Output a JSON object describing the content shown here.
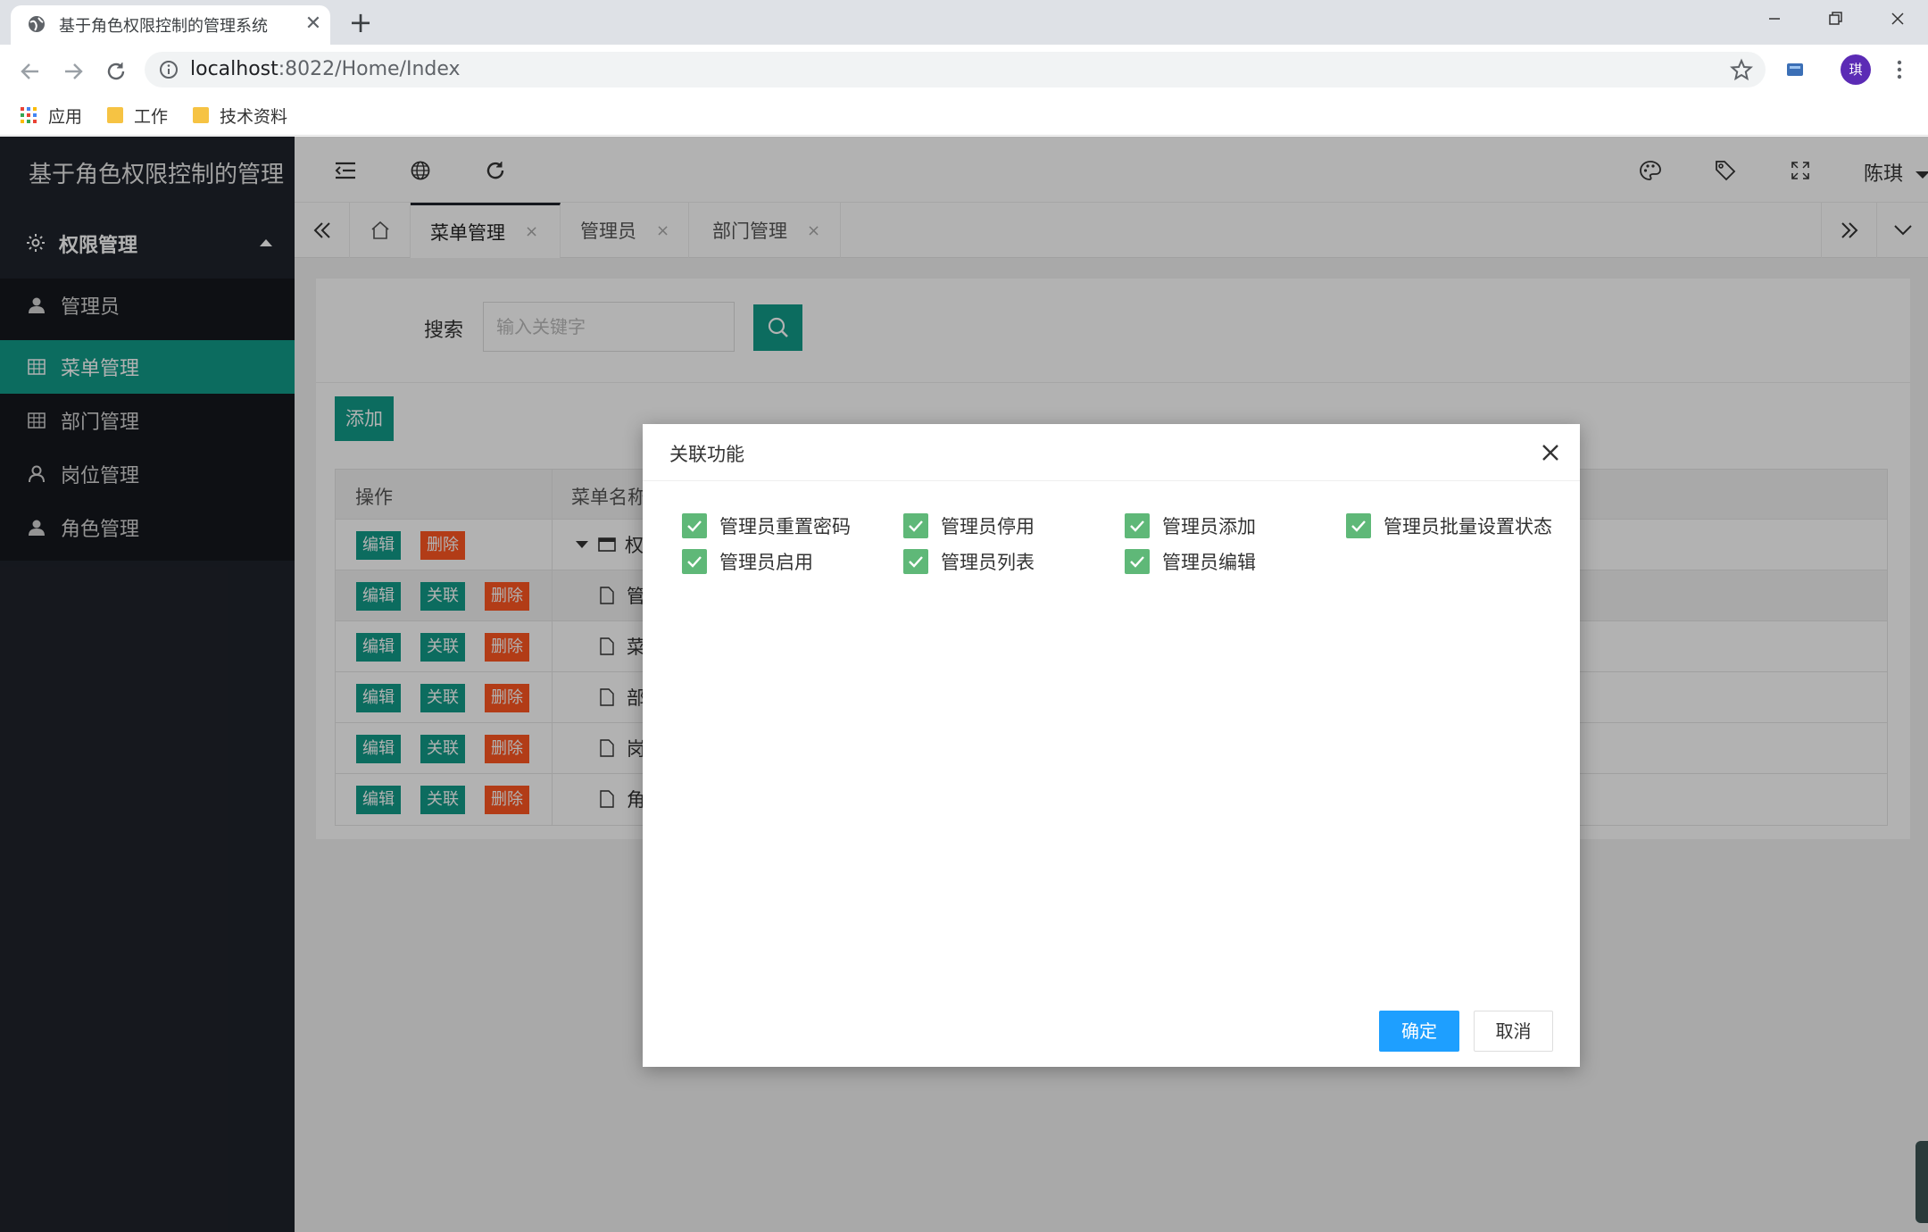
{
  "browser": {
    "tab_title": "基于角色权限控制的管理系统",
    "tab_close": "✕",
    "new_tab": "+",
    "url_host": "localhost",
    "url_rest": ":8022/Home/Index",
    "profile_initial": "琪",
    "bookmarks": [
      {
        "label": "应用",
        "icon": "apps-grid-icon"
      },
      {
        "label": "工作",
        "icon": "folder-icon"
      },
      {
        "label": "技术资料",
        "icon": "folder-icon"
      }
    ]
  },
  "app": {
    "logo": "基于角色权限控制的管理",
    "user": "陈琪",
    "sidebar": {
      "group_label": "权限管理",
      "items": [
        {
          "label": "管理员",
          "icon": "user-icon",
          "active": false
        },
        {
          "label": "菜单管理",
          "icon": "grid-icon",
          "active": true
        },
        {
          "label": "部门管理",
          "icon": "grid-icon",
          "active": false
        },
        {
          "label": "岗位管理",
          "icon": "person-outline-icon",
          "active": false
        },
        {
          "label": "角色管理",
          "icon": "user-icon",
          "active": false
        }
      ]
    },
    "page_tabs": [
      {
        "label": "菜单管理",
        "active": true
      },
      {
        "label": "管理员",
        "active": false
      },
      {
        "label": "部门管理",
        "active": false
      }
    ],
    "tab_close": "×",
    "search": {
      "label": "搜索",
      "placeholder": "输入关键字"
    },
    "add_button": "添加",
    "table": {
      "headers": [
        "操作",
        "菜单名称"
      ],
      "buttons": {
        "edit": "编辑",
        "link": "关联",
        "delete": "删除"
      },
      "rows": [
        {
          "name": "权",
          "type": "folder",
          "has_link": false
        },
        {
          "name": "管",
          "type": "file",
          "has_link": true
        },
        {
          "name": "菜",
          "type": "file",
          "has_link": true
        },
        {
          "name": "部",
          "type": "file",
          "has_link": true
        },
        {
          "name": "岗",
          "type": "file",
          "has_link": true
        },
        {
          "name": "角",
          "type": "file",
          "has_link": true
        }
      ]
    }
  },
  "modal": {
    "title": "关联功能",
    "checkboxes": [
      {
        "label": "管理员重置密码",
        "checked": true
      },
      {
        "label": "管理员停用",
        "checked": true
      },
      {
        "label": "管理员添加",
        "checked": true
      },
      {
        "label": "管理员批量设置状态",
        "checked": true
      },
      {
        "label": "管理员启用",
        "checked": true
      },
      {
        "label": "管理员列表",
        "checked": true
      },
      {
        "label": "管理员编辑",
        "checked": true
      }
    ],
    "confirm": "确定",
    "cancel": "取消"
  },
  "colors": {
    "accent": "#129b88",
    "danger": "#ff5722",
    "checkbox": "#5fb878",
    "primary": "#1e9fff",
    "sidebar": "#1f232b"
  }
}
